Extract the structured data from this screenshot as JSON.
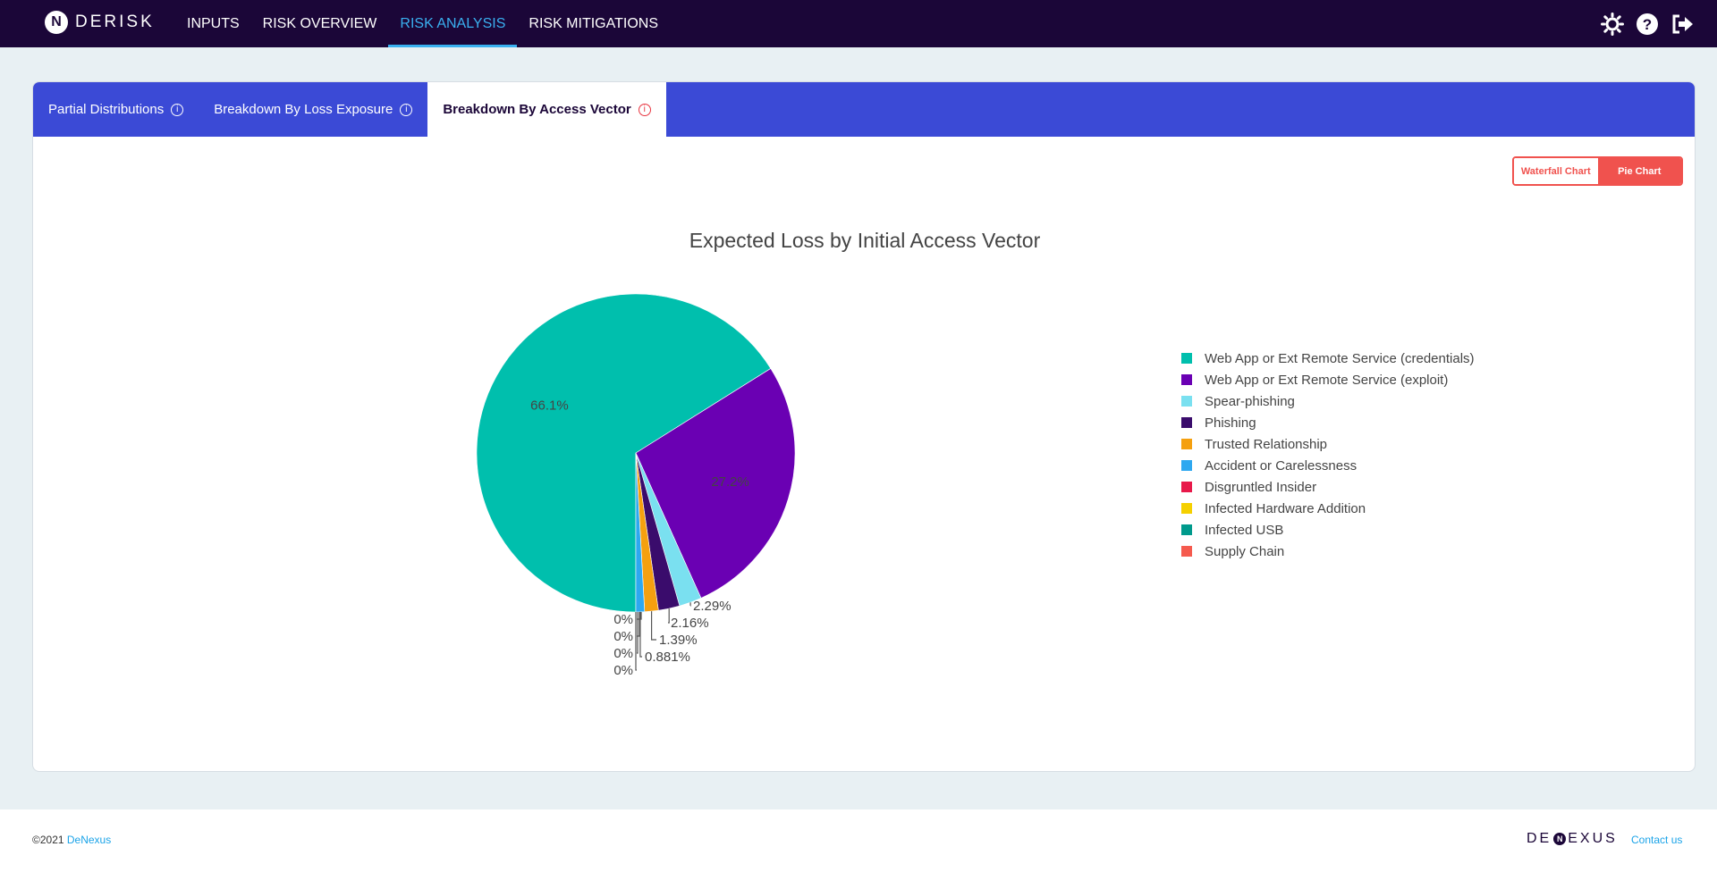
{
  "app": {
    "logo_text": "DERISK",
    "nav": [
      {
        "label": "INPUTS",
        "active": false
      },
      {
        "label": "RISK OVERVIEW",
        "active": false
      },
      {
        "label": "RISK ANALYSIS",
        "active": true
      },
      {
        "label": "RISK MITIGATIONS",
        "active": false
      }
    ],
    "icons": [
      "settings-sun-icon",
      "help-icon",
      "logout-icon"
    ]
  },
  "tabs": [
    {
      "label": "Partial Distributions",
      "active": false
    },
    {
      "label": "Breakdown By Loss Exposure",
      "active": false
    },
    {
      "label": "Breakdown By Access Vector",
      "active": true
    }
  ],
  "chart_toggle": {
    "waterfall_label": "Waterfall Chart",
    "pie_label": "Pie Chart",
    "selected": "Pie Chart"
  },
  "chart_data": {
    "type": "pie",
    "title": "Expected Loss by Initial Access Vector",
    "legend_position": "right",
    "slices": [
      {
        "label": "Web App or Ext Remote Service (credentials)",
        "value": 66.1,
        "display": "66.1%",
        "color": "#00bfad"
      },
      {
        "label": "Web App or Ext Remote Service (exploit)",
        "value": 27.2,
        "display": "27.2%",
        "color": "#6a00b3"
      },
      {
        "label": "Spear-phishing",
        "value": 2.29,
        "display": "2.29%",
        "color": "#7ae0f0"
      },
      {
        "label": "Phishing",
        "value": 2.16,
        "display": "2.16%",
        "color": "#3a0c6c"
      },
      {
        "label": "Trusted Relationship",
        "value": 1.39,
        "display": "1.39%",
        "color": "#f5a00f"
      },
      {
        "label": "Accident or Carelessness",
        "value": 0.881,
        "display": "0.881%",
        "color": "#2ea8f0"
      },
      {
        "label": "Disgruntled Insider",
        "value": 0,
        "display": "0%",
        "color": "#e8194a"
      },
      {
        "label": "Infected Hardware Addition",
        "value": 0,
        "display": "0%",
        "color": "#f5d000"
      },
      {
        "label": "Infected USB",
        "value": 0,
        "display": "0%",
        "color": "#009a8c"
      },
      {
        "label": "Supply Chain",
        "value": 0,
        "display": "0%",
        "color": "#f55a4e"
      }
    ]
  },
  "footer": {
    "copyright_prefix": "©2021 ",
    "copyright_link": "DeNexus",
    "brand_left": "DE",
    "brand_mark": "N",
    "brand_right": "EXUS",
    "contact_label": "Contact us"
  }
}
